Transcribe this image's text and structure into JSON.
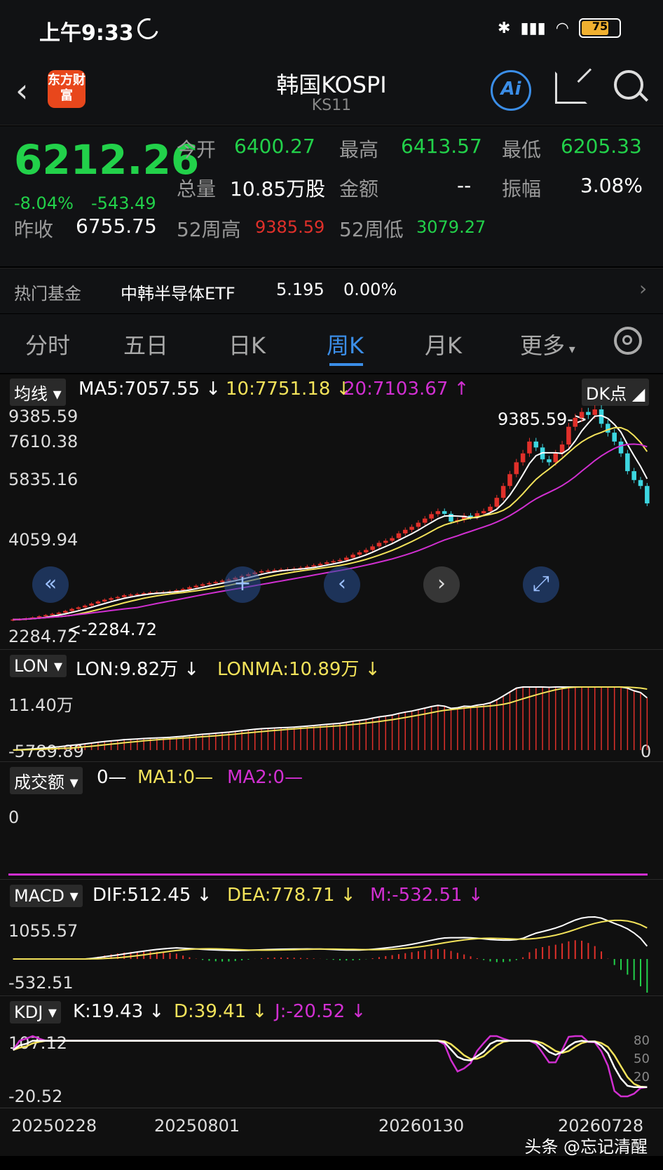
{
  "status": {
    "time": "上午9:33",
    "battery": "75"
  },
  "header": {
    "title": "韩国KOSPI",
    "code": "KS11",
    "logo_text": "东方财富",
    "ai_label": "Ai"
  },
  "quote": {
    "price": "6212.26",
    "change_pct": "-8.04%",
    "change": "-543.49",
    "open_label": "今开",
    "open": "6400.27",
    "high_label": "最高",
    "high": "6413.57",
    "low_label": "最低",
    "low": "6205.33",
    "volume_label": "总量",
    "volume": "10.85万股",
    "amount_label": "金额",
    "amount": "--",
    "amplitude_label": "振幅",
    "amplitude": "3.08%",
    "prev_close_label": "昨收",
    "prev_close": "6755.75",
    "wk52_high_label": "52周高",
    "wk52_high": "9385.59",
    "wk52_low_label": "52周低",
    "wk52_low": "3079.27"
  },
  "fund": {
    "label": "热门基金",
    "name": "中韩半导体ETF",
    "price": "5.195",
    "pct": "0.00%"
  },
  "tabs": [
    "分时",
    "五日",
    "日K",
    "周K",
    "月K",
    "更多"
  ],
  "active_tab": "周K",
  "ma": {
    "tag": "均线",
    "ma5": "MA5:7057.55",
    "ma10": "10:7751.18",
    "ma20": "20:7103.67",
    "dk": "DK点"
  },
  "kline_axis": [
    "9385.59",
    "7610.38",
    "5835.16",
    "4059.94",
    "2284.72"
  ],
  "kline_marks": {
    "high_label": "9385.59->",
    "low_label": "<-2284.72"
  },
  "lon": {
    "tag": "LON",
    "lon": "LON:9.82万",
    "lonma": "LONMA:10.89万",
    "top": "11.40万",
    "bottom": "-5789.89",
    "right": "0"
  },
  "amount_ind": {
    "tag": "成交额",
    "v": "0—",
    "ma1": "MA1:0—",
    "ma2": "MA2:0—",
    "axis": "0"
  },
  "macd": {
    "tag": "MACD",
    "dif": "DIF:512.45",
    "dea": "DEA:778.71",
    "m": "M:-532.51",
    "top": "1055.57",
    "bottom": "-532.51"
  },
  "kdj": {
    "tag": "KDJ",
    "k": "K:19.43",
    "d": "D:39.41",
    "j": "J:-20.52",
    "top": "107.12",
    "bottom": "-20.52",
    "r80": "80",
    "r50": "50",
    "r20": "20"
  },
  "dates": [
    "20250228",
    "20250801",
    "20260130",
    "20260728"
  ],
  "watermark": "头条 @忘记清醒",
  "colors": {
    "up": "#e0302a",
    "down": "#22d14a",
    "ma5": "#ffffff",
    "ma10": "#f2e25a",
    "ma20": "#d12fd1",
    "accent": "#3b8ee8"
  },
  "chart_data": {
    "type": "candlestick",
    "weekly_closes": [
      2290,
      2300,
      2330,
      2360,
      2400,
      2440,
      2480,
      2520,
      2580,
      2650,
      2700,
      2760,
      2830,
      2900,
      2960,
      3010,
      3050,
      3110,
      3130,
      3150,
      3180,
      3200,
      3210,
      3220,
      3240,
      3280,
      3320,
      3380,
      3430,
      3480,
      3520,
      3560,
      3600,
      3640,
      3700,
      3760,
      3820,
      3880,
      3920,
      3940,
      3960,
      3980,
      3990,
      4010,
      4040,
      4080,
      4120,
      4170,
      4220,
      4260,
      4300,
      4380,
      4480,
      4560,
      4640,
      4760,
      4880,
      4950,
      5040,
      5200,
      5320,
      5420,
      5560,
      5700,
      5850,
      5950,
      5860,
      5600,
      5650,
      5800,
      5750,
      5880,
      5950,
      6100,
      6400,
      6800,
      7200,
      7600,
      7900,
      8300,
      8100,
      7700,
      7600,
      7900,
      8200,
      8800,
      9100,
      9300,
      9200,
      9385,
      8900,
      8600,
      8300,
      7900,
      7300,
      7000,
      6800,
      6212
    ],
    "ylim": [
      2284.72,
      9385.59
    ]
  }
}
